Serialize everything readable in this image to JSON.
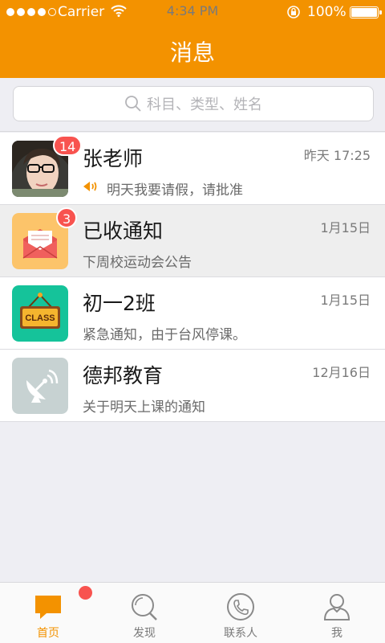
{
  "status_bar": {
    "carrier": "Carrier",
    "time": "4:34 PM",
    "battery": "100%"
  },
  "header": {
    "title": "消息"
  },
  "search": {
    "placeholder": "科目、类型、姓名"
  },
  "messages": [
    {
      "name": "张老师",
      "time": "昨天 17:25",
      "preview": "明天我要请假，请批准",
      "badge": "14",
      "avatar": "teacher-photo",
      "voice": true
    },
    {
      "name": "已收通知",
      "time": "1月15日",
      "preview": "下周校运动会公告",
      "badge": "3",
      "avatar": "envelope-icon",
      "accent": "#fcc46a"
    },
    {
      "name": "初一2班",
      "time": "1月15日",
      "preview": "紧急通知，由于台风停课。",
      "avatar": "class-sign-icon",
      "accent": "#15c39a",
      "sign_text": "CLASS"
    },
    {
      "name": "德邦教育",
      "time": "12月16日",
      "preview": "关于明天上课的通知",
      "avatar": "satellite-dish-icon",
      "accent": "#c7d2d2"
    }
  ],
  "tabbar": {
    "tabs": [
      {
        "label": "首页",
        "icon": "chat-bubble-icon",
        "active": true
      },
      {
        "label": "发现",
        "icon": "search-icon"
      },
      {
        "label": "联系人",
        "icon": "phone-icon"
      },
      {
        "label": "我",
        "icon": "user-icon"
      }
    ]
  },
  "colors": {
    "brand": "#f39200",
    "badge": "#f8534f"
  }
}
